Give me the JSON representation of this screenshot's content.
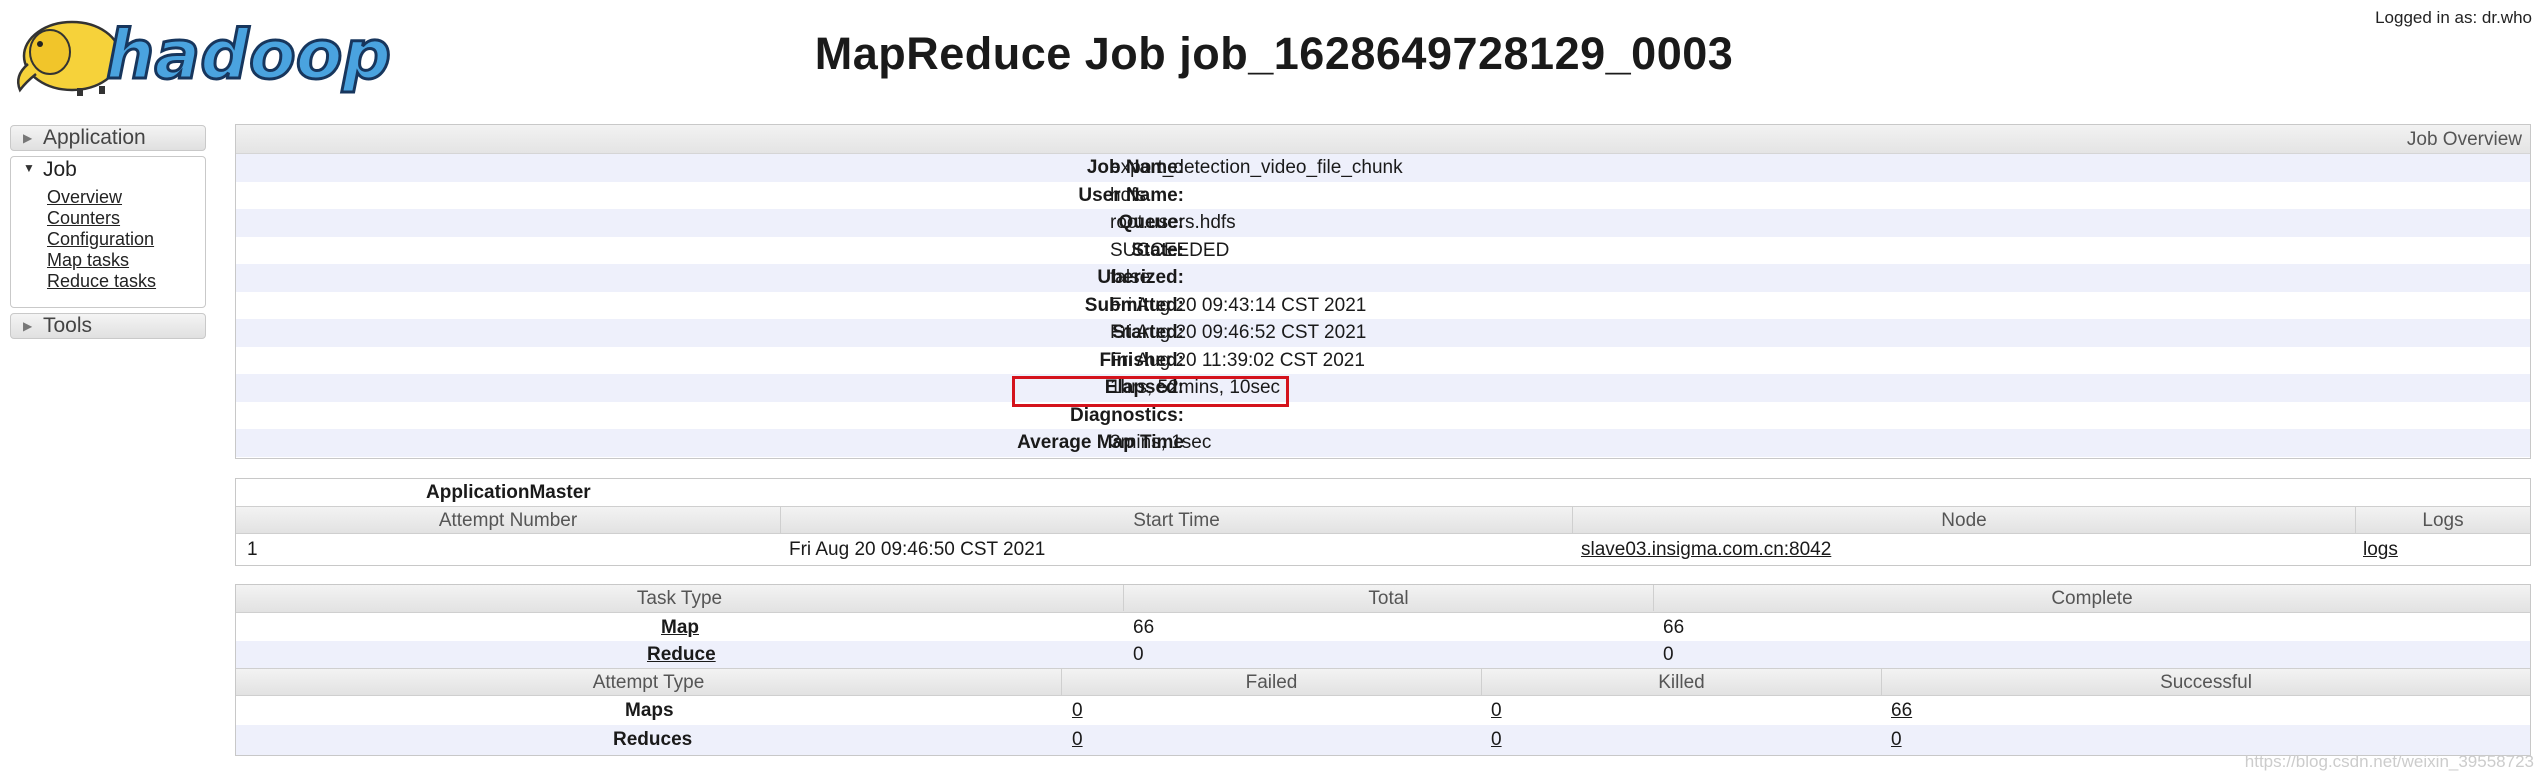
{
  "header": {
    "logo_text": "hadoop",
    "title": "MapReduce Job job_1628649728129_0003",
    "logged_in": "Logged in as: dr.who"
  },
  "sidebar": {
    "application": "Application",
    "job": "Job",
    "job_links": [
      "Overview",
      "Counters",
      "Configuration",
      "Map tasks",
      "Reduce tasks"
    ],
    "tools": "Tools"
  },
  "overview": {
    "header": "Job Overview",
    "rows": [
      {
        "label": "Job Name:",
        "value": "export_detection_video_file_chunk"
      },
      {
        "label": "User Name:",
        "value": "hdfs"
      },
      {
        "label": "Queue:",
        "value": "root.users.hdfs"
      },
      {
        "label": "State:",
        "value": "SUCCEEDED"
      },
      {
        "label": "Uberized:",
        "value": "false"
      },
      {
        "label": "Submitted:",
        "value": "Fri Aug 20 09:43:14 CST 2021"
      },
      {
        "label": "Started:",
        "value": "Fri Aug 20 09:46:52 CST 2021"
      },
      {
        "label": "Finished:",
        "value": "Fri Aug 20 11:39:02 CST 2021"
      },
      {
        "label": "Elapsed:",
        "value": "1hrs, 52mins, 10sec"
      },
      {
        "label": "Diagnostics:",
        "value": ""
      },
      {
        "label": "Average Map Time",
        "value": "3mins, 1sec"
      }
    ]
  },
  "am": {
    "title": "ApplicationMaster",
    "headers": [
      "Attempt Number",
      "Start Time",
      "Node",
      "Logs"
    ],
    "row": {
      "attempt": "1",
      "start_time": "Fri Aug 20 09:46:50 CST 2021",
      "node": "slave03.insigma.com.cn:8042",
      "logs": "logs"
    }
  },
  "tasks": {
    "headers": [
      "Task Type",
      "Total",
      "Complete"
    ],
    "rows": [
      {
        "type": "Map",
        "total": "66",
        "complete": "66"
      },
      {
        "type": "Reduce",
        "total": "0",
        "complete": "0"
      }
    ]
  },
  "attempts": {
    "headers": [
      "Attempt Type",
      "Failed",
      "Killed",
      "Successful"
    ],
    "rows": [
      {
        "type": "Maps",
        "failed": "0",
        "killed": "0",
        "successful": "66"
      },
      {
        "type": "Reduces",
        "failed": "0",
        "killed": "0",
        "successful": "0"
      }
    ]
  },
  "watermark": "https://blog.csdn.net/weixin_39558723",
  "colors": {
    "highlight": "#d4131c",
    "row_alt": "#eef0fb",
    "logo_blue": "#4aa3df",
    "logo_yellow": "#f6d23a"
  }
}
